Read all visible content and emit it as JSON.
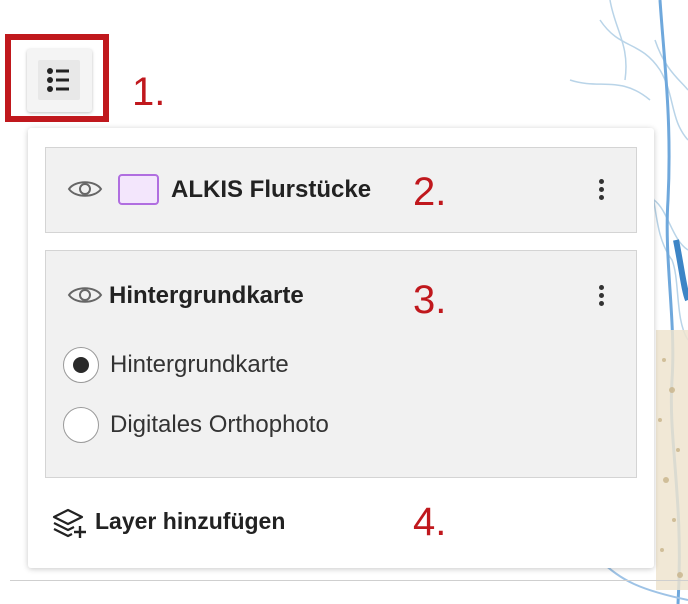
{
  "colors": {
    "annotation_red": "#c0181d",
    "swatch_purple": "#b06ee0",
    "card_bg": "#f1f1f1"
  },
  "toggle": {
    "icon": "list-icon"
  },
  "annotations": [
    "1.",
    "2.",
    "3.",
    "4."
  ],
  "layers": [
    {
      "title": "ALKIS Flurstücke",
      "visible_icon": "eye-icon",
      "swatch_icon": "polygon-swatch-icon",
      "menu_icon": "kebab-menu-icon"
    },
    {
      "title": "Hintergrundkarte",
      "visible_icon": "eye-icon",
      "menu_icon": "kebab-menu-icon",
      "options": [
        {
          "label": "Hintergrundkarte",
          "selected": true
        },
        {
          "label": "Digitales Orthophoto",
          "selected": false
        }
      ]
    }
  ],
  "add_layer": {
    "label": "Layer hinzufügen",
    "icon": "layers-add-icon"
  }
}
